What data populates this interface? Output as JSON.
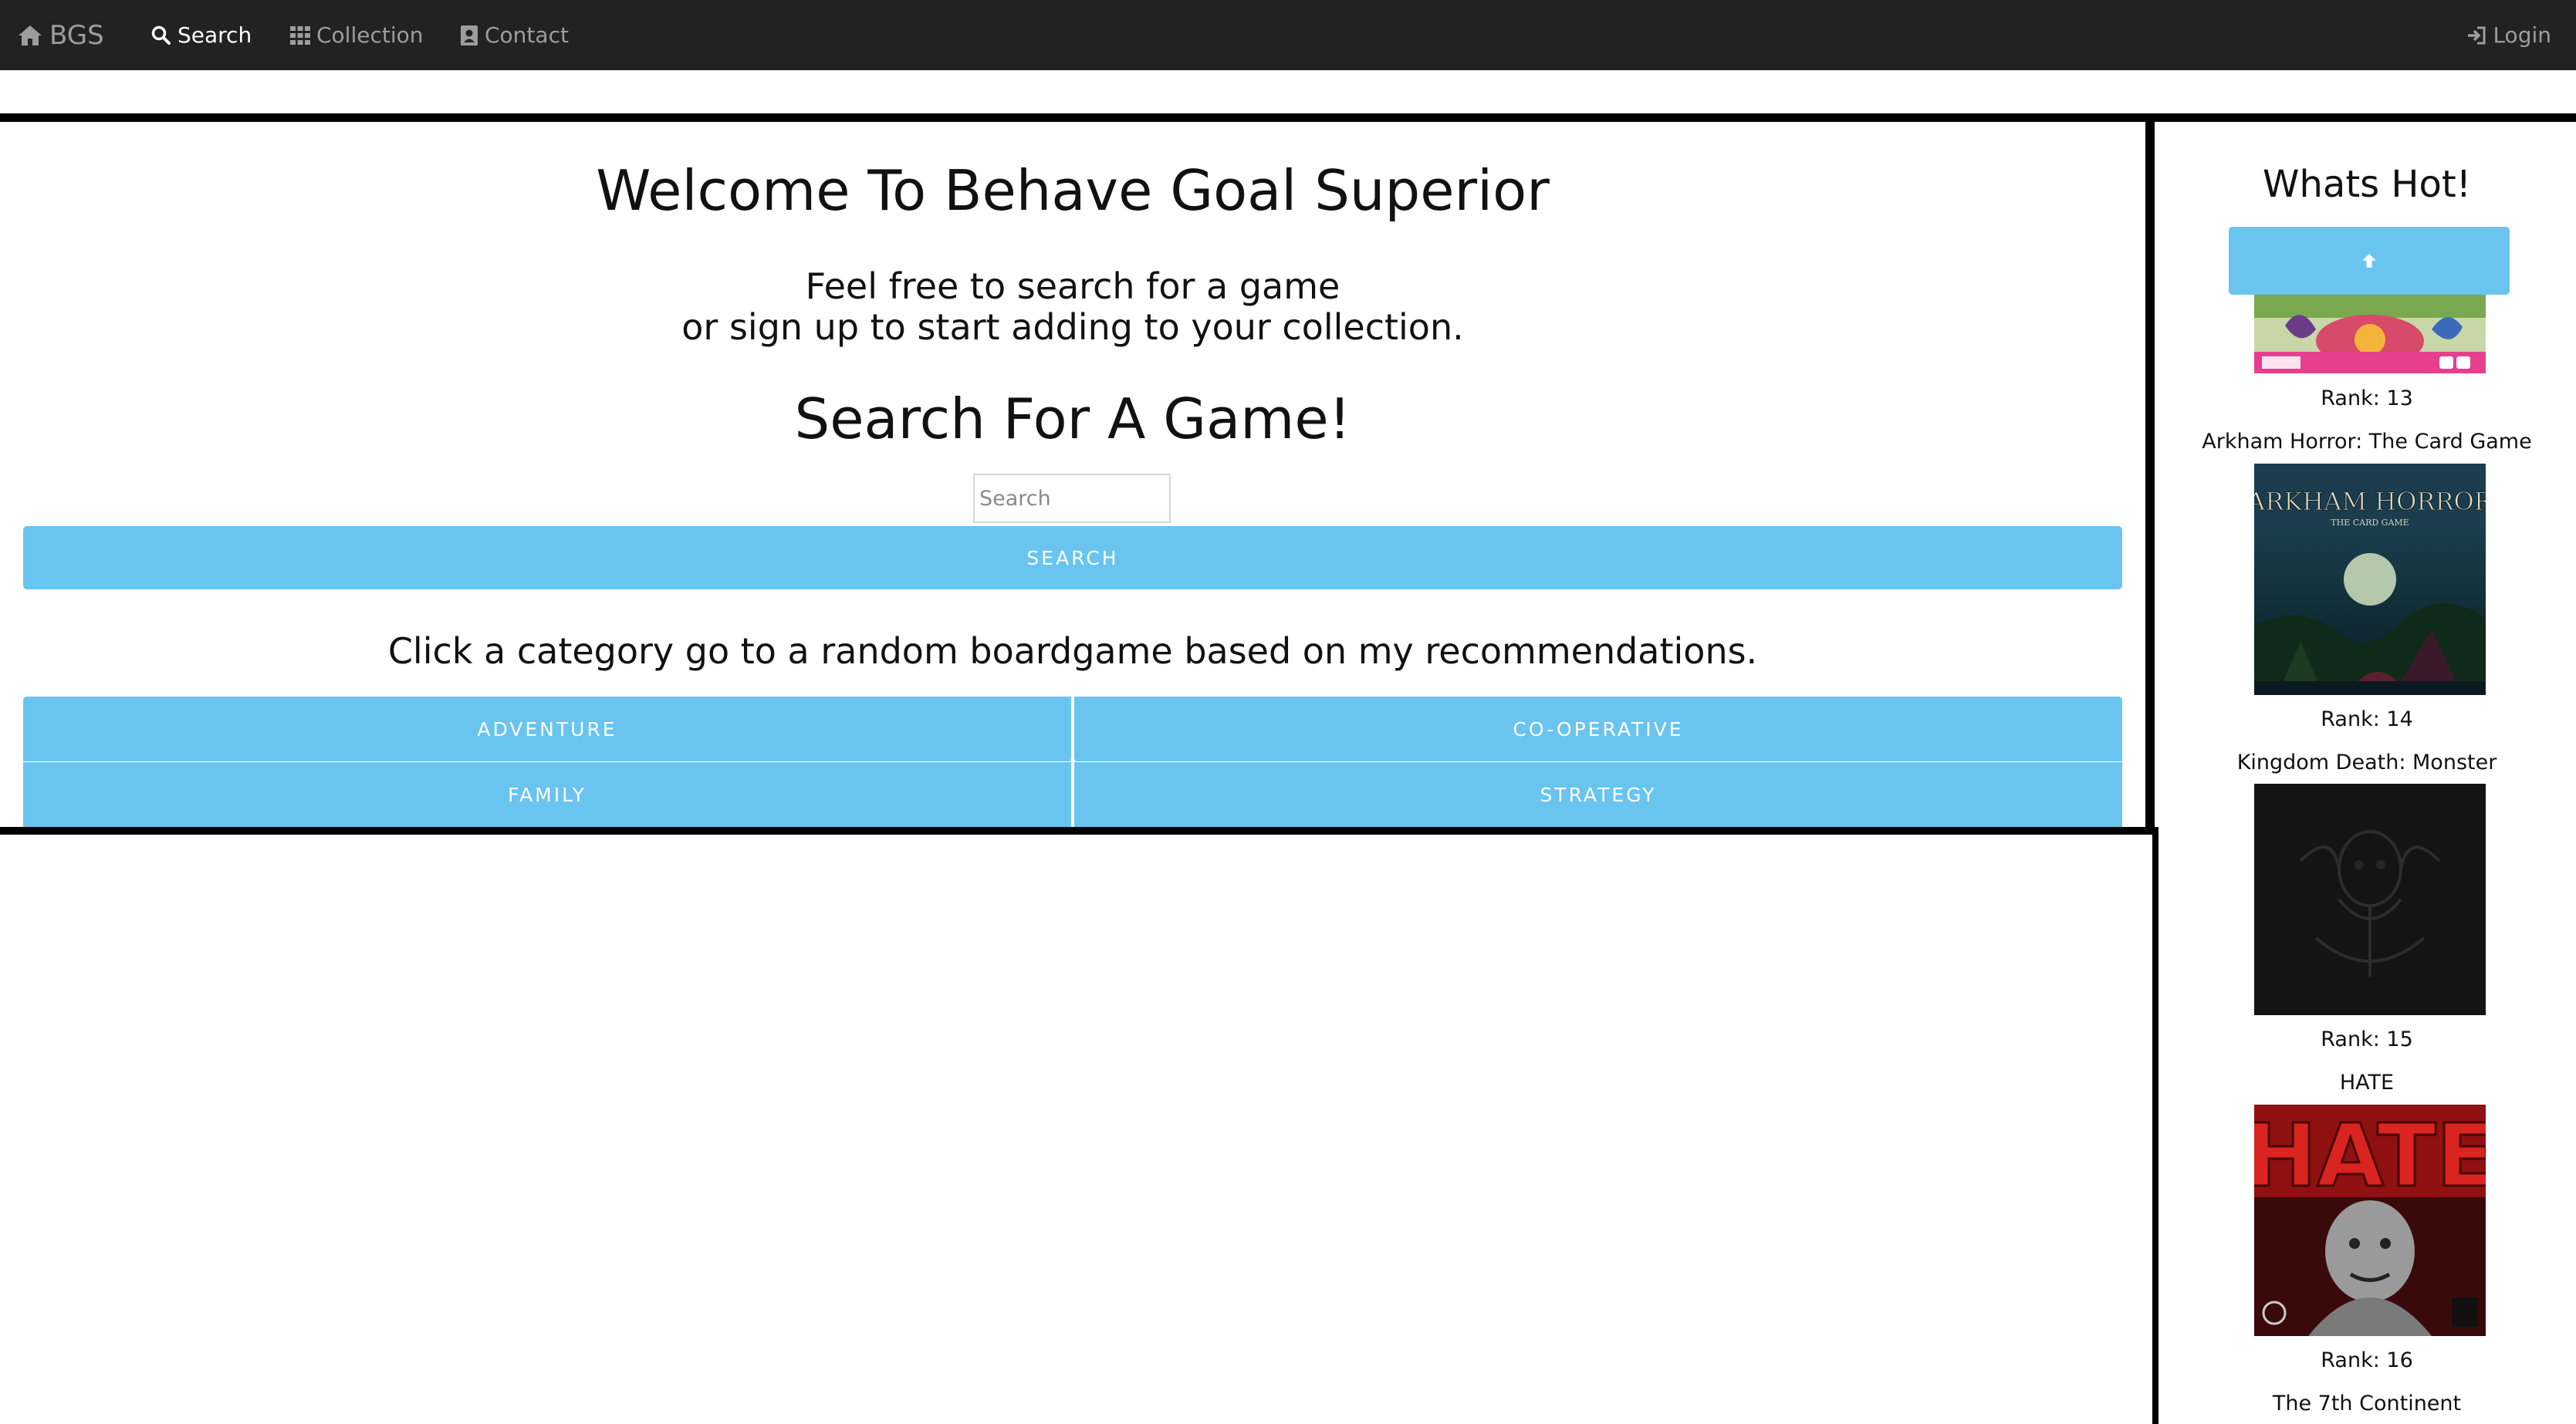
{
  "nav": {
    "brand": "BGS",
    "search": "Search",
    "collection": "Collection",
    "contact": "Contact",
    "login": "Login"
  },
  "main": {
    "welcome_title": "Welcome To Behave Goal Superior",
    "welcome_line1": "Feel free to search for a game",
    "welcome_line2": "or sign up to start adding to your collection.",
    "search_title": "Search For A Game!",
    "search_placeholder": "Search",
    "search_button": "SEARCH",
    "category_prompt": "Click a category go to a random boardgame based on my recommendations.",
    "categories": [
      "ADVENTURE",
      "CO-OPERATIVE",
      "FAMILY",
      "STRATEGY"
    ]
  },
  "sidebar": {
    "title": "Whats Hot!",
    "items": [
      {
        "rank": "Rank: 13",
        "name": ""
      },
      {
        "rank": "Rank: 14",
        "name": "Arkham Horror: The Card Game",
        "art_text": "ARKHAM HORROR",
        "art_sub": "THE CARD GAME"
      },
      {
        "rank": "Rank: 15",
        "name": "Kingdom Death: Monster"
      },
      {
        "rank": "Rank: 16",
        "name": "HATE",
        "art_text": "HATE"
      },
      {
        "rank": "",
        "name": "The 7th Continent"
      }
    ]
  },
  "colors": {
    "navbar": "#222222",
    "accent": "#69c4ef",
    "nav_text": "#9d9d9d",
    "nav_active": "#ffffff"
  }
}
